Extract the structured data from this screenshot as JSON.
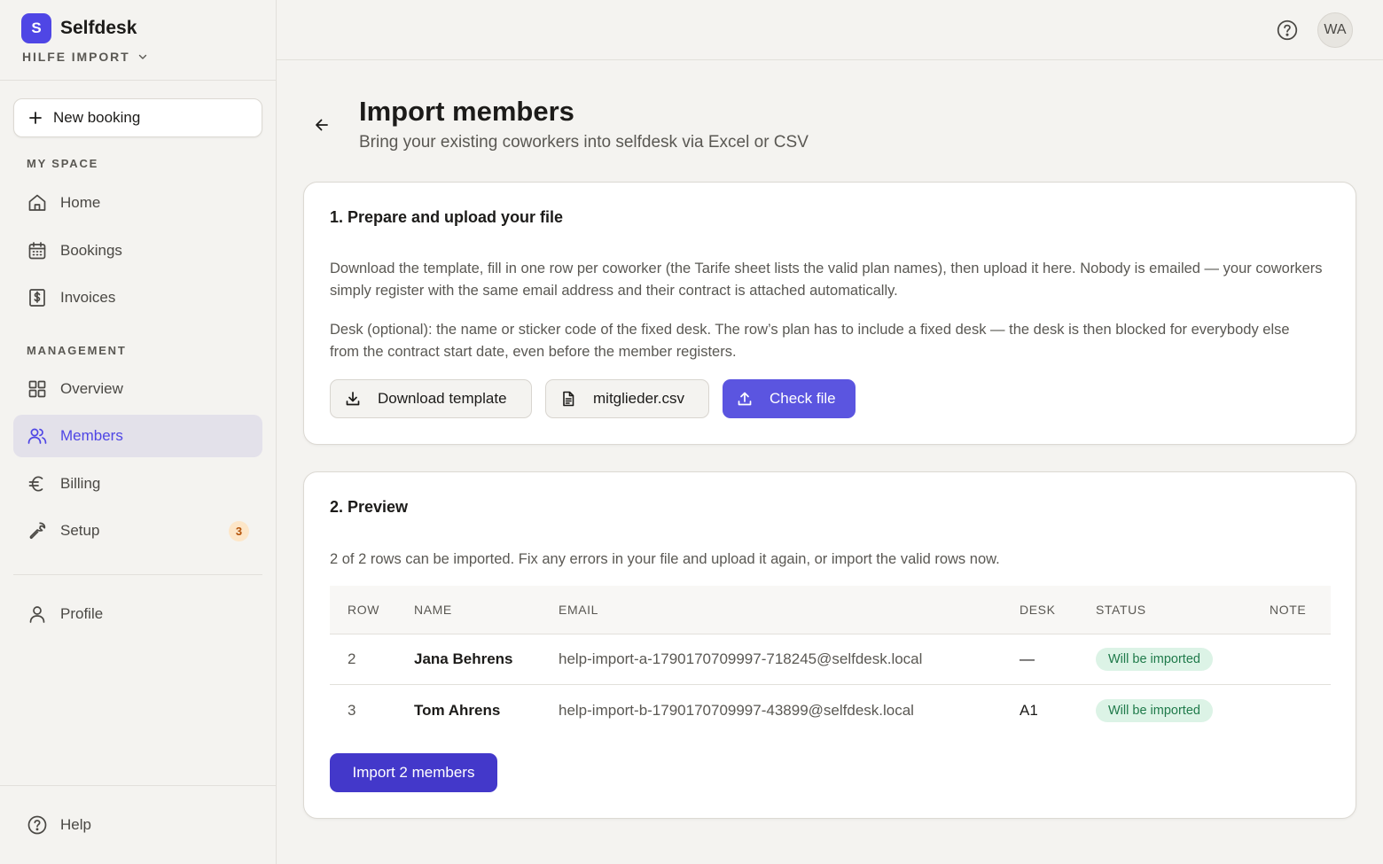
{
  "brand": {
    "logo_letter": "S",
    "name": "Selfdesk"
  },
  "workspace": {
    "name": "HILFE IMPORT"
  },
  "sidebar": {
    "new_booking": "New booking",
    "sections": {
      "my_space": "MY SPACE",
      "management": "MANAGEMENT"
    },
    "items": [
      {
        "label": "Home",
        "icon": "home-icon"
      },
      {
        "label": "Bookings",
        "icon": "calendar-icon"
      },
      {
        "label": "Invoices",
        "icon": "invoice-icon"
      },
      {
        "label": "Overview",
        "icon": "grid-icon"
      },
      {
        "label": "Members",
        "icon": "users-icon",
        "active": true
      },
      {
        "label": "Billing",
        "icon": "euro-icon"
      },
      {
        "label": "Setup",
        "icon": "wrench-icon",
        "badge": "3"
      },
      {
        "label": "Profile",
        "icon": "user-icon"
      }
    ],
    "help": "Help"
  },
  "topbar": {
    "avatar_initials": "WA"
  },
  "page": {
    "title": "Import members",
    "subtitle": "Bring your existing coworkers into selfdesk via Excel or CSV"
  },
  "upload_card": {
    "title": "1. Prepare and upload your file",
    "text1": "Download the template, fill in one row per coworker (the Tarife sheet lists the valid plan names), then upload it here. Nobody is emailed — your coworkers simply register with the same email address and their contract is attached automatically.",
    "text2": "Desk (optional): the name or sticker code of the fixed desk. The row’s plan has to include a fixed desk — the desk is then blocked for everybody else from the contract start date, even before the member registers.",
    "download_label": "Download template",
    "file_name": "mitglieder.csv",
    "check_label": "Check file"
  },
  "preview_card": {
    "title": "2. Preview",
    "summary": "2 of 2 rows can be imported. Fix any errors in your file and upload it again, or import the valid rows now.",
    "columns": {
      "row": "ROW",
      "name": "NAME",
      "email": "EMAIL",
      "desk": "DESK",
      "status": "STATUS",
      "note": "NOTE"
    },
    "rows": [
      {
        "row": "2",
        "name": "Jana Behrens",
        "email": "help-import-a-1790170709997-718245@selfdesk.local",
        "desk": "—",
        "status": "Will be imported",
        "note": ""
      },
      {
        "row": "3",
        "name": "Tom Ahrens",
        "email": "help-import-b-1790170709997-43899@selfdesk.local",
        "desk": "A1",
        "status": "Will be imported",
        "note": ""
      }
    ],
    "import_label": "Import 2 members"
  },
  "colors": {
    "accent": "#4f46e5",
    "status_bg": "#dcf3e6",
    "status_text": "#1f7a4a",
    "badge_bg": "#fde6c8"
  }
}
